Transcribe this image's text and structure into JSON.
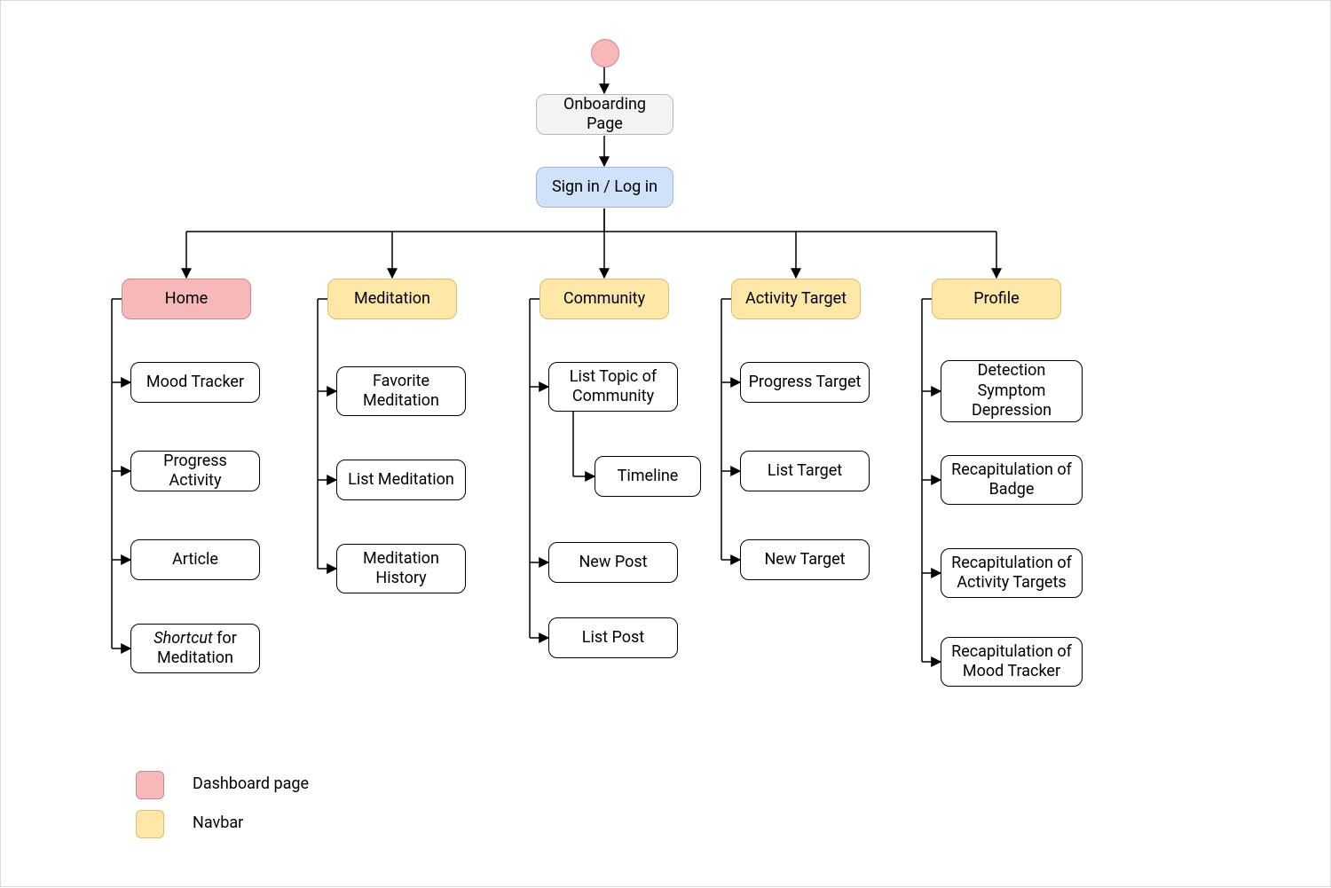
{
  "top": {
    "onboarding": "Onboarding Page",
    "signin": "Sign in / Log in"
  },
  "columns": {
    "home": {
      "head": "Home",
      "items": [
        "Mood Tracker",
        "Progress Activity",
        "Article"
      ],
      "shortcut_prefix": "Shortcut",
      "shortcut_suffix": " for Meditation"
    },
    "meditation": {
      "head": "Meditation",
      "items": [
        "Favorite Meditation",
        "List Meditation",
        "Meditation History"
      ]
    },
    "community": {
      "head": "Community",
      "items": [
        "List Topic of Community",
        "Timeline",
        "New Post",
        "List Post"
      ]
    },
    "activity": {
      "head": "Activity Target",
      "items": [
        "Progress Target",
        "List Target",
        "New Target"
      ]
    },
    "profile": {
      "head": "Profile",
      "items": [
        "Detection Symptom Depression",
        "Recapitulation of Badge",
        "Recapitulation of Activity Targets",
        "Recapitulation of Mood Tracker"
      ]
    }
  },
  "legend": {
    "dashboard": "Dashboard page",
    "navbar": "Navbar"
  },
  "colors": {
    "pink_fill": "#f6b8b8",
    "pink_border": "#d08787",
    "yellow_fill": "#fce7a6",
    "yellow_border": "#d9bf6f",
    "blue_fill": "#cfe2f7",
    "blue_border": "#9ab8d9",
    "grey_fill": "#f3f3f3",
    "grey_border": "#b8b8b8"
  }
}
